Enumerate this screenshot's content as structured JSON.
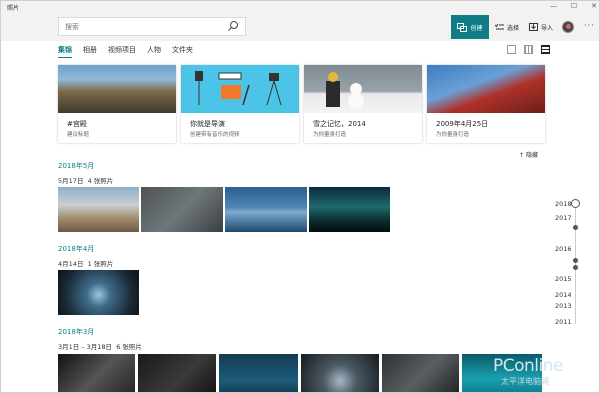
{
  "app": {
    "title": "照片"
  },
  "window": {
    "minimize": "—",
    "maximize": "☐",
    "close": "✕"
  },
  "header": {
    "search_placeholder": "搜索",
    "create_label": "创建",
    "select_label": "选择",
    "import_label": "导入",
    "more_label": "···"
  },
  "tabs": [
    {
      "label": "集锦"
    },
    {
      "label": "相册"
    },
    {
      "label": "视频项目"
    },
    {
      "label": "人物"
    },
    {
      "label": "文件夹"
    }
  ],
  "albums": [
    {
      "title": "#宫殿",
      "subtitle": "建议标题"
    },
    {
      "title": "你就是导演",
      "subtitle": "创建带有音乐的视频"
    },
    {
      "title": "雪之记忆，2014",
      "subtitle": "为你量身打造"
    },
    {
      "title": "2009年4月25日",
      "subtitle": "为你量身打造"
    }
  ],
  "hide_label": "隐藏",
  "sections": [
    {
      "month": "2018年5月",
      "date": "5月17日",
      "count": "4 张照片"
    },
    {
      "month": "2018年4月",
      "date": "4月14日",
      "count": "1 张照片"
    },
    {
      "month": "2018年3月",
      "date": "3月1日 – 3月18日",
      "count": "6 张照片"
    }
  ],
  "timeline": [
    "2018",
    "2017",
    "2016",
    "2015",
    "2014",
    "2013",
    "2011"
  ],
  "watermark": {
    "brand": "PConline",
    "sub": "太平洋电脑网"
  },
  "colors": {
    "accent": "#0f7c86"
  }
}
